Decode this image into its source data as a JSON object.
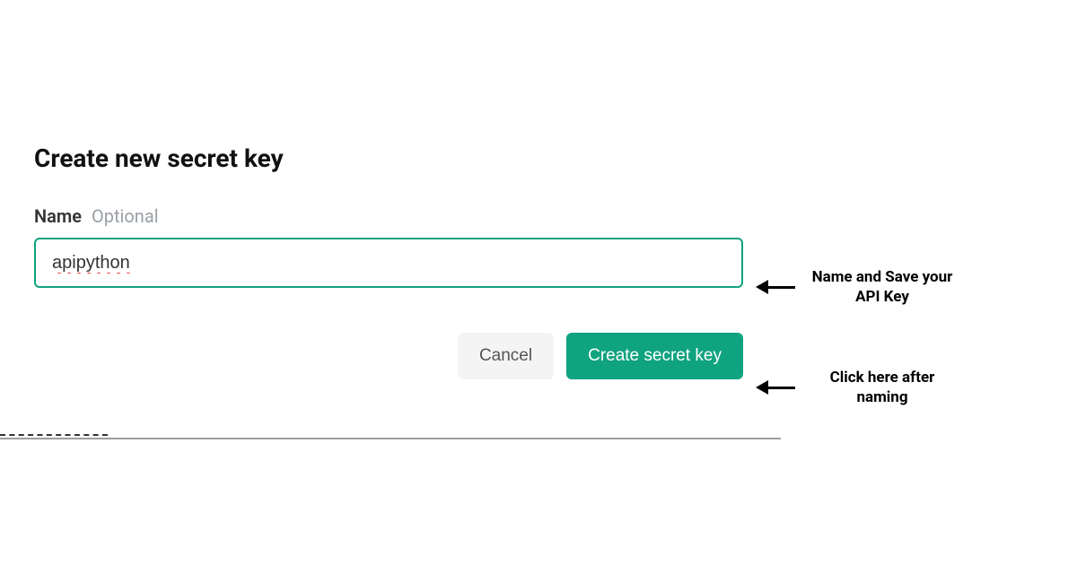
{
  "dialog": {
    "title": "Create new secret key",
    "name_label": "Name",
    "name_hint": "Optional",
    "name_value": "apipython",
    "cancel_label": "Cancel",
    "create_label": "Create secret key"
  },
  "annotations": {
    "input": "Name and Save your API Key",
    "button": "Click here after naming"
  },
  "colors": {
    "accent": "#10a37f"
  }
}
